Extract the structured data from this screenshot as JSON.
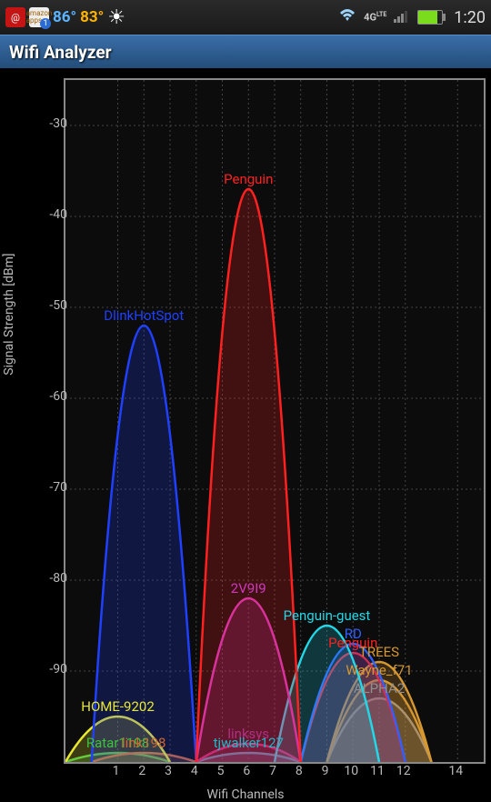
{
  "status": {
    "temp1": "86°",
    "temp2": "83°",
    "time": "1:20"
  },
  "app": {
    "title": "Wifi Analyzer"
  },
  "chart_data": {
    "type": "area",
    "title": "",
    "xlabel": "Wifi Channels",
    "ylabel": "Signal Strength [dBm]",
    "xlim": [
      -1,
      15
    ],
    "ylim": [
      -100,
      -25
    ],
    "x_ticks": [
      1,
      2,
      3,
      4,
      5,
      6,
      7,
      8,
      9,
      10,
      11,
      12,
      14
    ],
    "y_ticks": [
      -30,
      -40,
      -50,
      -60,
      -70,
      -80,
      -90
    ],
    "series": [
      {
        "name": "Penguin",
        "channel": 6,
        "peak_dbm": -37,
        "color": "#ff2020"
      },
      {
        "name": "DlinkHotSpot",
        "channel": 2,
        "peak_dbm": -52,
        "color": "#2040ff"
      },
      {
        "name": "Penguin-guest",
        "channel": 9,
        "peak_dbm": -85,
        "color": "#20d8e8"
      },
      {
        "name": "2V9I9",
        "channel": 6,
        "peak_dbm": -82,
        "color": "#d038c0"
      },
      {
        "name": "RD",
        "channel": 10,
        "peak_dbm": -87,
        "color": "#3060ff"
      },
      {
        "name": "Penguin",
        "channel": 10,
        "peak_dbm": -88,
        "color": "#ff2020"
      },
      {
        "name": "TREES",
        "channel": 11,
        "peak_dbm": -89,
        "color": "#d89830"
      },
      {
        "name": "Wayne_f71",
        "channel": 11,
        "peak_dbm": -91,
        "color": "#d89830"
      },
      {
        "name": "ALPHA2",
        "channel": 11,
        "peak_dbm": -93,
        "color": "#909090"
      },
      {
        "name": "HOME-9202",
        "channel": 1,
        "peak_dbm": -95,
        "color": "#e8e830"
      },
      {
        "name": "linksys",
        "channel": 6,
        "peak_dbm": -98,
        "color": "#b03080"
      },
      {
        "name": "tjwalker127",
        "channel": 6,
        "peak_dbm": -99,
        "color": "#20b8c8"
      },
      {
        "name": "Ratar1198",
        "channel": 1,
        "peak_dbm": -99,
        "color": "#40c040"
      },
      {
        "name": "link198",
        "channel": 2,
        "peak_dbm": -99,
        "color": "#d06830"
      }
    ]
  }
}
